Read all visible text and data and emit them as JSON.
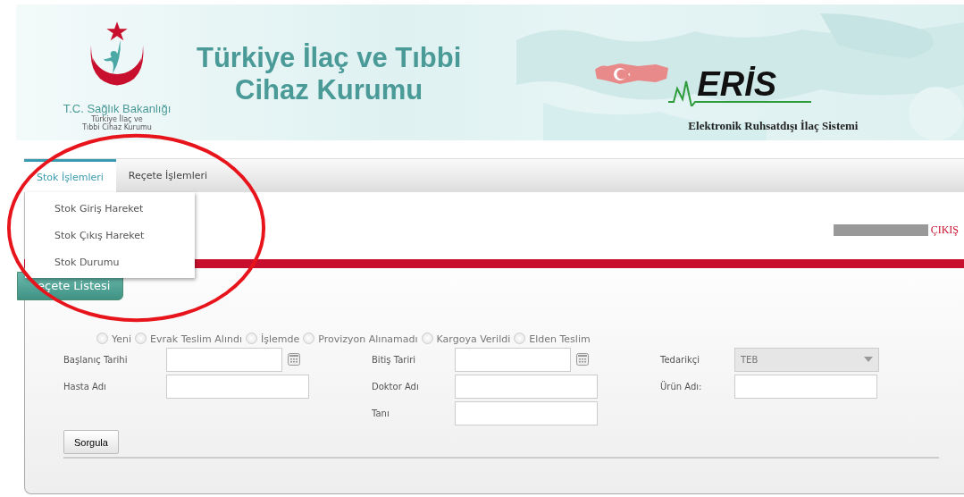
{
  "header": {
    "ministry": "T.C. Sağlık Bakanlığı",
    "agency_small": [
      "Türkiye İlaç ve",
      "Tıbbi Cihaz Kurumu"
    ],
    "title": [
      "Türkiye İlaç ve Tıbbi",
      "Cihaz Kurumu"
    ],
    "system_logo": "ERİS",
    "system_name": "Elektronik Ruhsatdışı İlaç Sistemi"
  },
  "tabs": [
    {
      "label": "Stok İşlemleri",
      "selected": true
    },
    {
      "label": "Reçete İşlemleri",
      "selected": false
    }
  ],
  "dropdown": {
    "open": true,
    "items": [
      "Stok Giriş Hareket",
      "Stok Çıkış Hareket",
      "Stok Durumu"
    ]
  },
  "user_bar": {
    "logout": "ÇIKIŞ"
  },
  "panel": {
    "title": "eçete Listesi",
    "statuses": [
      {
        "label": "Yeni",
        "selected": false
      },
      {
        "label": "Evrak Teslim Alındı",
        "selected": false
      },
      {
        "label": "İşlemde",
        "selected": false
      },
      {
        "label": "Provizyon Alınamadı",
        "selected": false
      },
      {
        "label": "Kargoya Verildi",
        "selected": false
      },
      {
        "label": "Elden Teslim",
        "selected": false
      }
    ],
    "rows": [
      {
        "left": {
          "label": "Başlanıç Tarihi",
          "kind": "date"
        },
        "middle": {
          "label": "Bitiş Tariri",
          "kind": "date"
        },
        "right": {
          "label": "Tedarikçi",
          "kind": "select",
          "value": "TEB",
          "disabled": true
        }
      },
      {
        "left": {
          "label": "Hasta Adı",
          "kind": "text"
        },
        "middle": {
          "label": "Doktor Adı",
          "kind": "text"
        },
        "right": {
          "label": "Ürün Adı:",
          "kind": "text"
        }
      },
      {
        "middle": {
          "label": "Tanı",
          "kind": "text"
        }
      }
    ],
    "button": "Sorgula"
  },
  "annotation": {
    "kind": "circle"
  }
}
